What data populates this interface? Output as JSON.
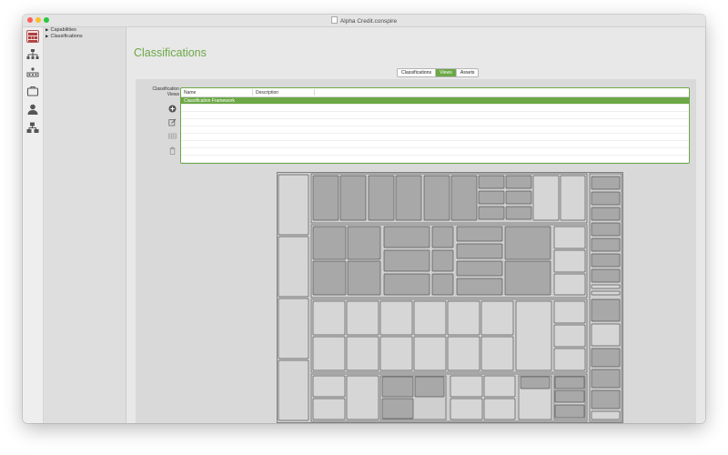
{
  "window": {
    "title": "Alpha Credit.conspire",
    "traffic_lights": [
      "#fd5f57",
      "#fdbc2e",
      "#28c940"
    ]
  },
  "toolbar": {
    "icons": [
      "dashboard-icon",
      "hierarchy-icon",
      "org-chart-icon",
      "briefcase-icon",
      "person-icon",
      "flow-icon"
    ]
  },
  "tree": {
    "items": [
      {
        "label": "Capabilities"
      },
      {
        "label": "Classifications"
      }
    ]
  },
  "main": {
    "heading": "Classifications",
    "tabs": [
      {
        "label": "Classifications",
        "active": false
      },
      {
        "label": "Views",
        "active": true
      },
      {
        "label": "Assets",
        "active": false
      }
    ],
    "side_label": "Classification Views",
    "side_buttons": [
      "add-icon",
      "edit-icon",
      "view-grid-icon",
      "trash-icon"
    ],
    "table": {
      "columns": [
        "Name",
        "Description"
      ],
      "rows": [
        {
          "name": "Classification Framework",
          "description": "",
          "selected": true
        }
      ]
    }
  },
  "colors": {
    "accent": "#6ca846",
    "tile_light": "#d6d6d6",
    "tile_dark": "#a8a8a8"
  }
}
